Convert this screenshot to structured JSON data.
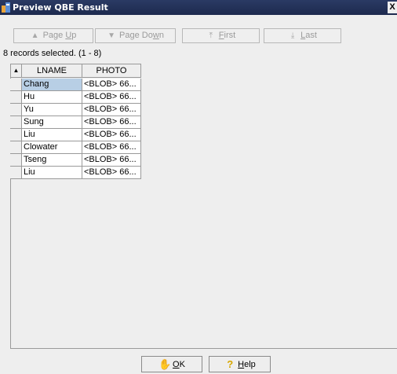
{
  "window": {
    "title": "Preview QBE Result",
    "close_label": "X"
  },
  "toolbar": {
    "buttons": [
      {
        "label_pre": "Page ",
        "mnemonic": "U",
        "label_post": "p",
        "icon": "arrow-up-icon"
      },
      {
        "label_pre": "Page Do",
        "mnemonic": "w",
        "label_post": "n",
        "icon": "arrow-down-icon"
      },
      {
        "label_pre": "",
        "mnemonic": "F",
        "label_post": "irst",
        "icon": "first-icon"
      },
      {
        "label_pre": "",
        "mnemonic": "L",
        "label_post": "ast",
        "icon": "last-icon"
      }
    ]
  },
  "status": "8 records selected. (1 - 8)",
  "table": {
    "sort_indicator": "▲",
    "columns": [
      "LNAME",
      "PHOTO"
    ],
    "rows": [
      [
        "Chang",
        "<BLOB> 66..."
      ],
      [
        "Hu",
        "<BLOB> 66..."
      ],
      [
        "Yu",
        "<BLOB> 66..."
      ],
      [
        "Sung",
        "<BLOB> 66..."
      ],
      [
        "Liu",
        "<BLOB> 66..."
      ],
      [
        "Clowater",
        "<BLOB> 66..."
      ],
      [
        "Tseng",
        "<BLOB> 66..."
      ],
      [
        "Liu",
        "<BLOB> 66..."
      ]
    ]
  },
  "footer": {
    "ok": {
      "label_pre": "",
      "mnemonic": "O",
      "label_post": "K",
      "icon": "hand-icon"
    },
    "help": {
      "label_pre": "",
      "mnemonic": "H",
      "label_post": "elp",
      "icon": "question-icon"
    }
  },
  "colors": {
    "titlebar": "#1d2a4e",
    "selected_row": "#b8cfe5",
    "disabled_text": "#9b9b9b"
  }
}
